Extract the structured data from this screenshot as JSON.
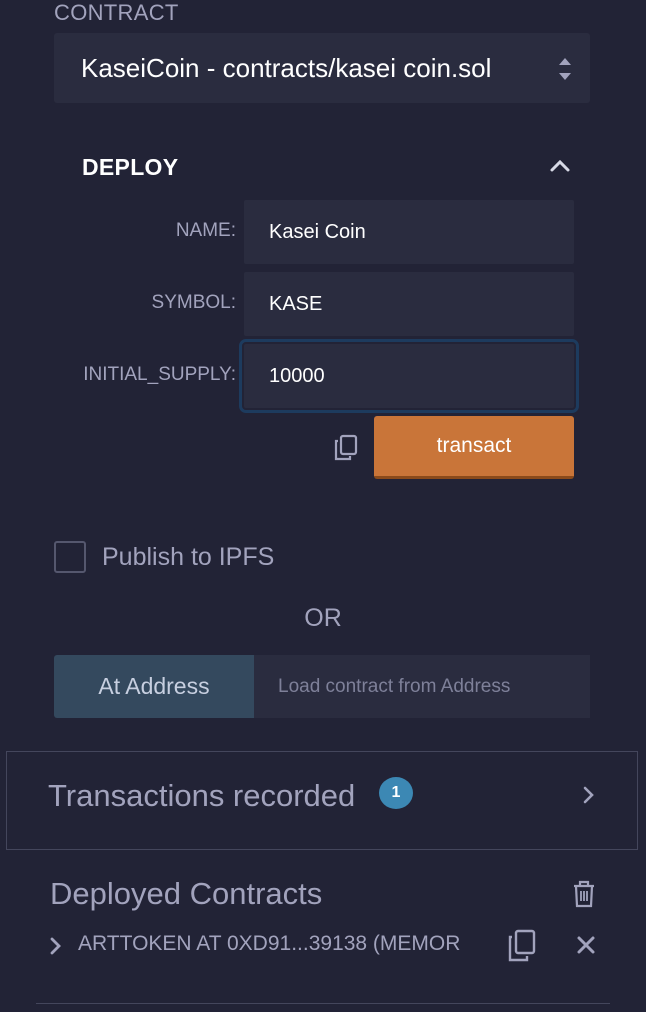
{
  "contract": {
    "label": "CONTRACT",
    "selected": "KaseiCoin - contracts/kasei coin.sol"
  },
  "deploy": {
    "title": "DEPLOY",
    "fields": [
      {
        "label": "NAME:",
        "value": "Kasei Coin"
      },
      {
        "label": "SYMBOL:",
        "value": "KASE"
      },
      {
        "label": "INITIAL_SUPPLY:",
        "value": "10000"
      }
    ],
    "transact_label": "transact"
  },
  "publish": {
    "label": "Publish to IPFS",
    "checked": false
  },
  "or_label": "OR",
  "at_address": {
    "button_label": "At Address",
    "placeholder": "Load contract from Address"
  },
  "transactions": {
    "title": "Transactions recorded",
    "count": "1"
  },
  "deployed": {
    "title": "Deployed Contracts",
    "items": [
      {
        "label": "ARTTOKEN AT 0XD91...39138 (MEMOR"
      }
    ]
  },
  "colors": {
    "background": "#222336",
    "input_bg": "#2a2c3f",
    "transact": "#c97539",
    "at_address": "#34495e",
    "badge": "#3c88b4",
    "text": "#a2a3bd"
  },
  "icons": [
    "select-arrows-icon",
    "chevron-up-icon",
    "copy-icon",
    "chevron-right-icon",
    "trash-icon",
    "close-icon"
  ]
}
